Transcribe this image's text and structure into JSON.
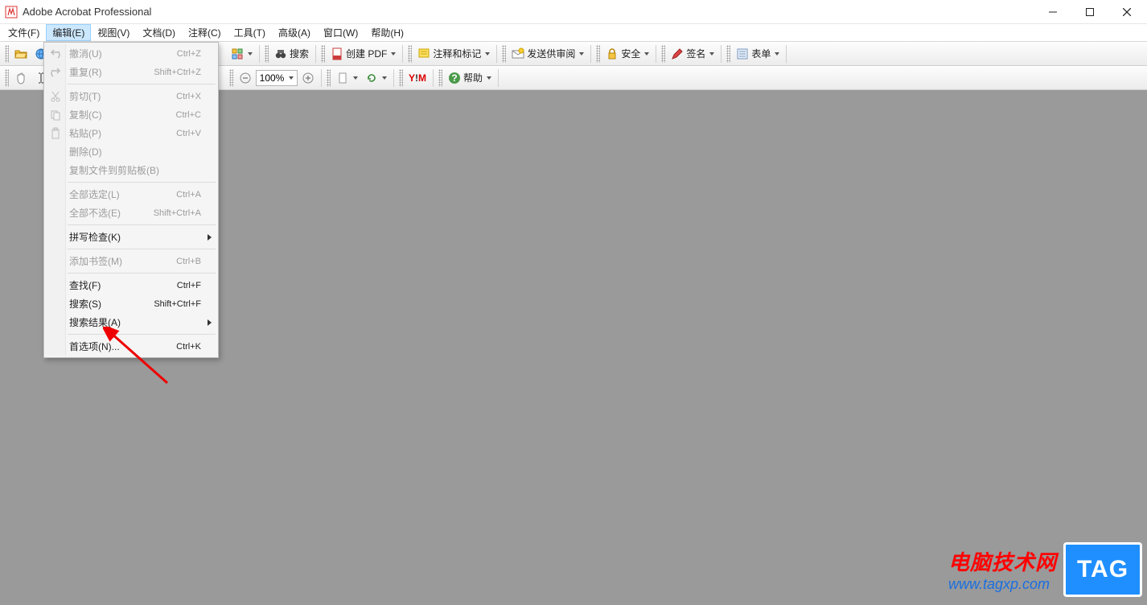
{
  "window": {
    "title": "Adobe Acrobat Professional"
  },
  "menubar": {
    "file": "文件(F)",
    "edit": "编辑(E)",
    "view": "视图(V)",
    "document": "文档(D)",
    "comments": "注释(C)",
    "tools": "工具(T)",
    "advanced": "高级(A)",
    "window": "窗口(W)",
    "help": "帮助(H)"
  },
  "toolbar1": {
    "search": "搜索",
    "createpdf": "创建 PDF",
    "annotate": "注释和标记",
    "sendreview": "发送供审阅",
    "security": "安全",
    "sign": "签名",
    "forms": "表单"
  },
  "toolbar2": {
    "zoom": "100%",
    "help": "帮助"
  },
  "edit_menu": {
    "undo": {
      "label": "撤消(U)",
      "shortcut": "Ctrl+Z"
    },
    "redo": {
      "label": "重复(R)",
      "shortcut": "Shift+Ctrl+Z"
    },
    "cut": {
      "label": "剪切(T)",
      "shortcut": "Ctrl+X"
    },
    "copy": {
      "label": "复制(C)",
      "shortcut": "Ctrl+C"
    },
    "paste": {
      "label": "粘贴(P)",
      "shortcut": "Ctrl+V"
    },
    "delete": {
      "label": "删除(D)"
    },
    "copyclip": {
      "label": "复制文件到剪贴板(B)"
    },
    "selectall": {
      "label": "全部选定(L)",
      "shortcut": "Ctrl+A"
    },
    "deselect": {
      "label": "全部不选(E)",
      "shortcut": "Shift+Ctrl+A"
    },
    "spell": {
      "label": "拼写检查(K)"
    },
    "bookmark": {
      "label": "添加书签(M)",
      "shortcut": "Ctrl+B"
    },
    "find": {
      "label": "查找(F)",
      "shortcut": "Ctrl+F"
    },
    "search": {
      "label": "搜索(S)",
      "shortcut": "Shift+Ctrl+F"
    },
    "results": {
      "label": "搜索结果(A)"
    },
    "prefs": {
      "label": "首选项(N)...",
      "shortcut": "Ctrl+K"
    }
  },
  "watermark": {
    "line1": "电脑技术网",
    "line2": "www.tagxp.com",
    "tag": "TAG"
  }
}
